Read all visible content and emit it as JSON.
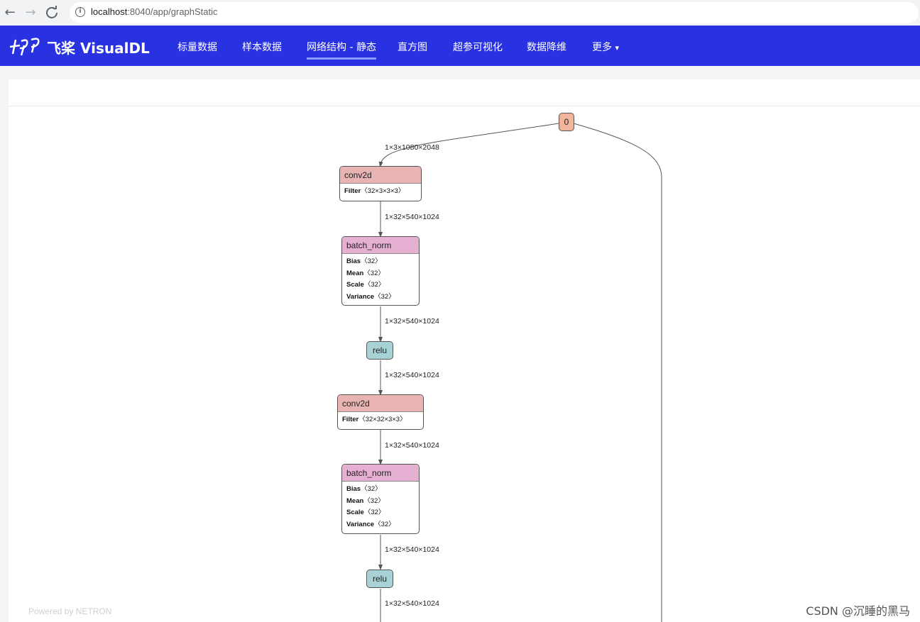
{
  "browser": {
    "back": "←",
    "forward": "→",
    "reload": "C",
    "url_host": "localhost",
    "url_rest": ":8040/app/graphStatic"
  },
  "header": {
    "logo_text": "飞桨 VisualDL",
    "nav": [
      {
        "label": "标量数据"
      },
      {
        "label": "样本数据"
      },
      {
        "label": "网络结构 - 静态"
      },
      {
        "label": "直方图"
      },
      {
        "label": "超参可视化"
      },
      {
        "label": "数据降维"
      },
      {
        "label": "更多"
      }
    ],
    "more_caret": "▾"
  },
  "graph": {
    "input_node": "0",
    "edges": [
      "1×3×1080×2048",
      "1×32×540×1024",
      "1×32×540×1024",
      "1×32×540×1024",
      "1×32×540×1024",
      "1×32×540×1024",
      "1×32×540×1024"
    ],
    "conv1": {
      "title": "conv2d",
      "attr_name": "Filter",
      "attr_val": "〈32×3×3×3〉"
    },
    "bn1": {
      "title": "batch_norm",
      "attrs": [
        {
          "name": "Bias",
          "val": "〈32〉"
        },
        {
          "name": "Mean",
          "val": "〈32〉"
        },
        {
          "name": "Scale",
          "val": "〈32〉"
        },
        {
          "name": "Variance",
          "val": "〈32〉"
        }
      ]
    },
    "relu1": "relu",
    "conv2": {
      "title": "conv2d",
      "attr_name": "Filter",
      "attr_val": "〈32×32×3×3〉"
    },
    "bn2": {
      "title": "batch_norm",
      "attrs": [
        {
          "name": "Bias",
          "val": "〈32〉"
        },
        {
          "name": "Mean",
          "val": "〈32〉"
        },
        {
          "name": "Scale",
          "val": "〈32〉"
        },
        {
          "name": "Variance",
          "val": "〈32〉"
        }
      ]
    },
    "relu2": "relu"
  },
  "footer": {
    "powered": "Powered by NETRON",
    "watermark": "CSDN @沉睡的黑马"
  },
  "colors": {
    "header_bg": "#2932e1",
    "conv": "#e8b3b3",
    "batch_norm": "#e6b0d2",
    "relu": "#a8d2d6",
    "input": "#f0b59a"
  }
}
